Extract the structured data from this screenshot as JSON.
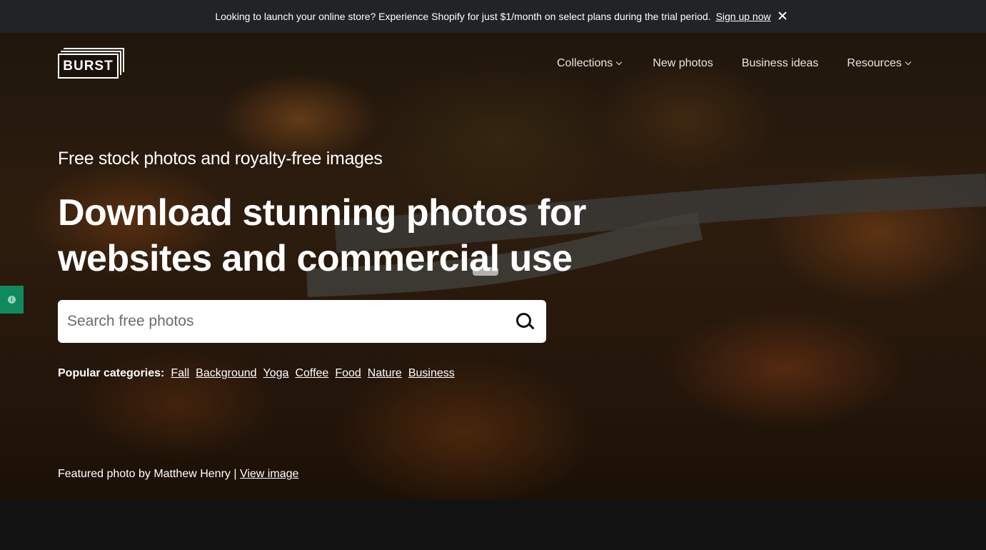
{
  "announcement": {
    "message": "Looking to launch your online store? Experience Shopify for just $1/month on select plans during the trial period.",
    "link": "Sign up now",
    "close_icon": "close-icon"
  },
  "header": {
    "logo_text": "BURST",
    "nav": [
      {
        "label": "Collections",
        "has_dropdown": true
      },
      {
        "label": "New photos",
        "has_dropdown": false
      },
      {
        "label": "Business ideas",
        "has_dropdown": false
      },
      {
        "label": "Resources",
        "has_dropdown": true
      }
    ]
  },
  "hero": {
    "subtitle": "Free stock photos and royalty-free images",
    "headline": "Download stunning photos for websites and commercial use",
    "search": {
      "placeholder": "Search free photos",
      "value": "",
      "icon": "search-icon"
    },
    "popular_label": "Popular categories:",
    "categories": [
      "Fall",
      "Background",
      "Yoga",
      "Coffee",
      "Food",
      "Nature",
      "Business"
    ],
    "credit_text": "Featured photo by Matthew Henry |",
    "credit_link": "View image"
  },
  "side_tab": {
    "icon": "info-icon",
    "glyph": "i"
  },
  "colors": {
    "announcement_bg": "#212326",
    "side_tab": "#0f8a5f",
    "page_bg": "#121212"
  }
}
